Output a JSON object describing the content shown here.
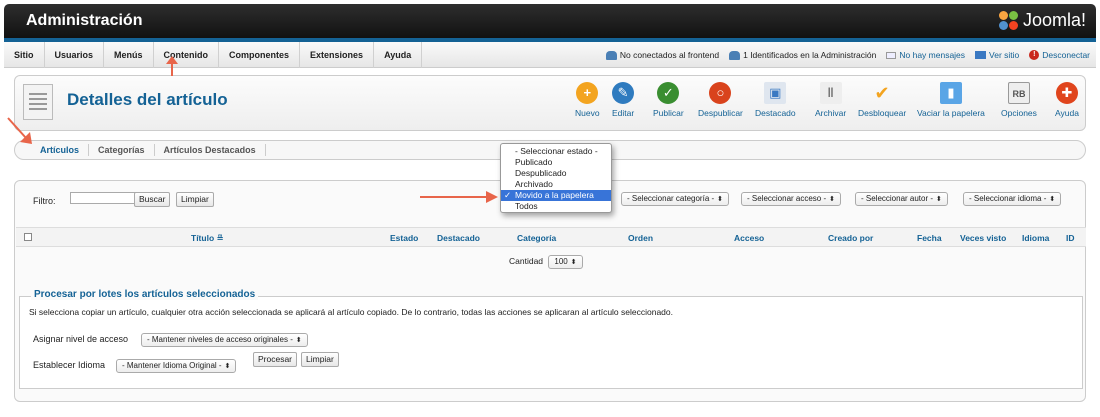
{
  "header": {
    "title": "Administración",
    "logo_text": "Joomla!"
  },
  "menu": [
    "Sitio",
    "Usuarios",
    "Menús",
    "Contenido",
    "Componentes",
    "Extensiones",
    "Ayuda"
  ],
  "status": {
    "frontend": "No conectados al frontend",
    "admin": "1 Identificados en la Administración",
    "messages": "No hay mensajes",
    "view_site": "Ver sitio",
    "logout": "Desconectar"
  },
  "toolbar": {
    "title": "Detalles del artículo",
    "buttons": [
      {
        "label": "Nuevo",
        "icon": "plus-icon",
        "color": "#f3a420"
      },
      {
        "label": "Editar",
        "icon": "pencil-icon",
        "color": "#2f7bbf"
      },
      {
        "label": "Publicar",
        "icon": "check-icon",
        "color": "#3a8e31"
      },
      {
        "label": "Despublicar",
        "icon": "unpublish-icon",
        "color": "#d9431c"
      },
      {
        "label": "Destacado",
        "icon": "featured-icon",
        "color": "#3b79c2"
      },
      {
        "label": "Archivar",
        "icon": "archive-icon",
        "color": "#777777"
      },
      {
        "label": "Desbloquear",
        "icon": "checkmark-icon",
        "color": "#f3a420"
      },
      {
        "label": "Vaciar la papelera",
        "icon": "trash-icon",
        "color": "#2f7bbf"
      },
      {
        "label": "Opciones",
        "icon": "options-icon",
        "color": "#888888"
      },
      {
        "label": "Ayuda",
        "icon": "help-icon",
        "color": "#e0451d"
      }
    ]
  },
  "tabs": [
    "Artículos",
    "Categorías",
    "Artículos Destacados"
  ],
  "filter": {
    "label": "Filtro:",
    "search_value": "",
    "search_button": "Buscar",
    "clear_button": "Limpiar",
    "selects": [
      "- Seleccionar categoría -",
      "- Seleccionar acceso -",
      "- Seleccionar autor -",
      "- Seleccionar idioma -"
    ]
  },
  "status_dropdown": {
    "options": [
      "- Seleccionar estado -",
      "Publicado",
      "Despublicado",
      "Archivado",
      "Movido a la papelera",
      "Todos"
    ],
    "selected": "Movido a la papelera"
  },
  "table": {
    "columns": [
      "Título",
      "Estado",
      "Destacado",
      "Categoría",
      "Orden",
      "Acceso",
      "Creado por",
      "Fecha",
      "Veces visto",
      "Idioma",
      "ID"
    ]
  },
  "pagination": {
    "label": "Cantidad",
    "value": "100"
  },
  "batch": {
    "legend": "Procesar por lotes los artículos seleccionados",
    "description": "Si selecciona copiar un artículo, cualquier otra acción seleccionada se aplicará al artículo copiado. De lo contrario, todas las acciones se aplicaran al artículo seleccionado.",
    "access_label": "Asignar nivel de acceso",
    "access_value": "- Mantener niveles de acceso originales -",
    "language_label": "Establecer Idioma",
    "language_value": "- Mantener Idioma Original -",
    "process_button": "Procesar",
    "clear_button": "Limpiar"
  },
  "colors": {
    "accent": "#146295",
    "arrow": "#e8654a"
  }
}
